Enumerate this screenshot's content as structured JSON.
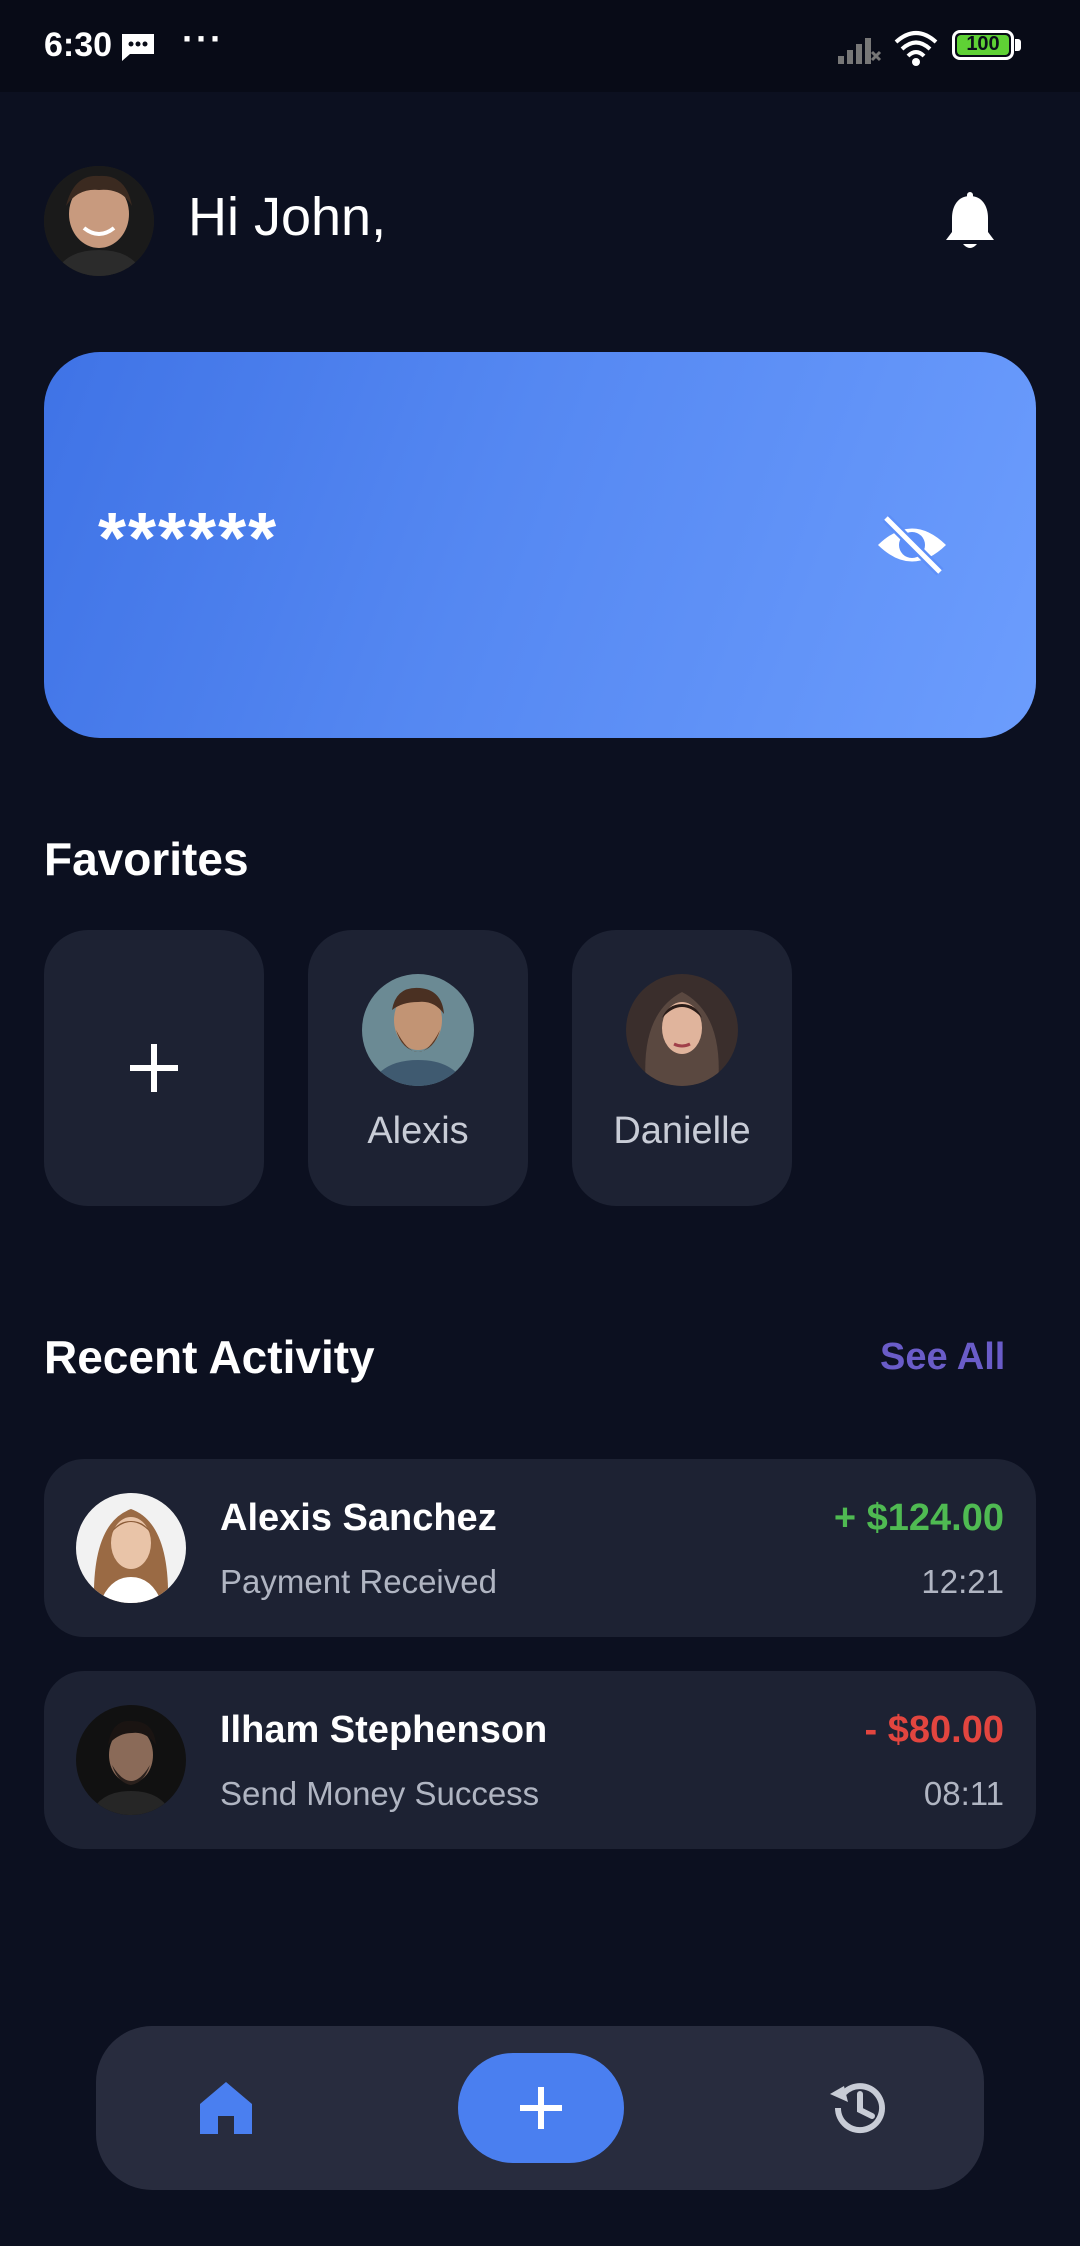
{
  "status_bar": {
    "time": "6:30",
    "dots": "···",
    "battery": "100"
  },
  "header": {
    "greeting": "Hi John,"
  },
  "balance_card": {
    "masked_balance": "******"
  },
  "favorites": {
    "title": "Favorites",
    "people": [
      {
        "name": "Alexis"
      },
      {
        "name": "Danielle"
      }
    ]
  },
  "recent_activity": {
    "title": "Recent Activity",
    "see_all": "See All",
    "transactions": [
      {
        "name": "Alexis Sanchez",
        "status": "Payment Received",
        "amount": "+ $124.00",
        "time": "12:21",
        "amount_color": "#4fba52"
      },
      {
        "name": "Ilham Stephenson",
        "status": "Send Money Success",
        "amount": "- $80.00",
        "time": "08:11",
        "amount_color": "#e2453f"
      }
    ]
  },
  "colors": {
    "accent": "#4a7ff0",
    "background": "#0c1020",
    "surface": "#1d2233",
    "see_all": "#6a5cc8"
  },
  "icons": [
    "message-icon",
    "signal-icon",
    "wifi-icon",
    "battery-icon",
    "bell-icon",
    "eye-off-icon",
    "plus-icon",
    "home-icon",
    "history-icon"
  ]
}
